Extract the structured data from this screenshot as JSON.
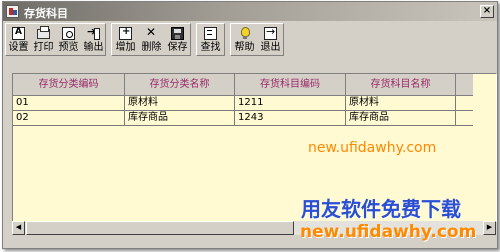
{
  "window": {
    "title": "存货科目",
    "close_label": "×"
  },
  "toolbar": {
    "setup": "设置",
    "print": "打印",
    "preview": "预览",
    "export": "输出",
    "add": "增加",
    "delete": "删除",
    "save": "保存",
    "find": "查找",
    "help": "帮助",
    "exit": "退出"
  },
  "table": {
    "columns": [
      "存货分类编码",
      "存货分类名称",
      "存货科目编码",
      "存货科目名称"
    ],
    "rows": [
      [
        "01",
        "原材料",
        "1211",
        "原材料"
      ],
      [
        "02",
        "库存商品",
        "1243",
        "库存商品"
      ]
    ]
  },
  "scrollbar": {
    "left_arrow": "◀",
    "right_arrow": "▶"
  },
  "watermark": {
    "url_top": "new.ufidawhy.com",
    "brand": "用友软件免费下载",
    "url_bottom": "new.ufidawhy.com"
  },
  "colors": {
    "grid_bg": "#fffad2",
    "header_text": "#9a2a6a",
    "window_face": "#d4d0c8"
  }
}
